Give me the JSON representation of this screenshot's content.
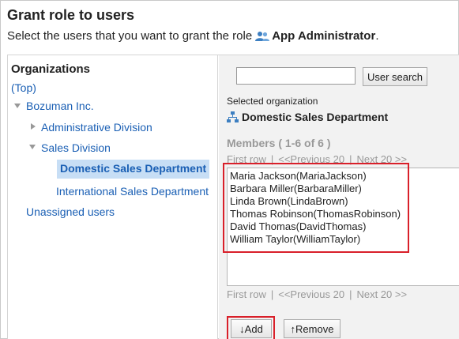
{
  "page": {
    "title": "Grant role to users",
    "instruction_prefix": "Select the users that you want to grant the role",
    "role_name": "App Administrator",
    "instruction_suffix": "."
  },
  "organizations": {
    "heading": "Organizations",
    "top_link": "(Top)",
    "company": "Bozuman Inc.",
    "divisions": [
      {
        "label": "Administrative Division"
      },
      {
        "label": "Sales Division"
      }
    ],
    "departments": [
      {
        "label": "Domestic Sales Department"
      },
      {
        "label": "International Sales Department"
      }
    ],
    "unassigned": "Unassigned users"
  },
  "search": {
    "value": "",
    "button_label": "User search"
  },
  "selection": {
    "label": "Selected organization",
    "organization": "Domestic Sales Department"
  },
  "members": {
    "heading": "Members ( 1-6 of 6 )",
    "pager": {
      "first": "First row",
      "separator": "|",
      "previous": "<<Previous 20",
      "next": "Next 20 >>"
    },
    "items": [
      "Maria Jackson(MariaJackson)",
      "Barbara Miller(BarbaraMiller)",
      "Linda Brown(LindaBrown)",
      "Thomas Robinson(ThomasRobinson)",
      "David Thomas(DavidThomas)",
      "William Taylor(WilliamTaylor)"
    ]
  },
  "actions": {
    "add_label": "↓Add",
    "remove_label": "↑Remove"
  },
  "colors": {
    "link": "#1a5fb4",
    "selected_bg": "#c7def5",
    "highlight": "#d9202a",
    "pane_bg": "#f2f2f2"
  }
}
